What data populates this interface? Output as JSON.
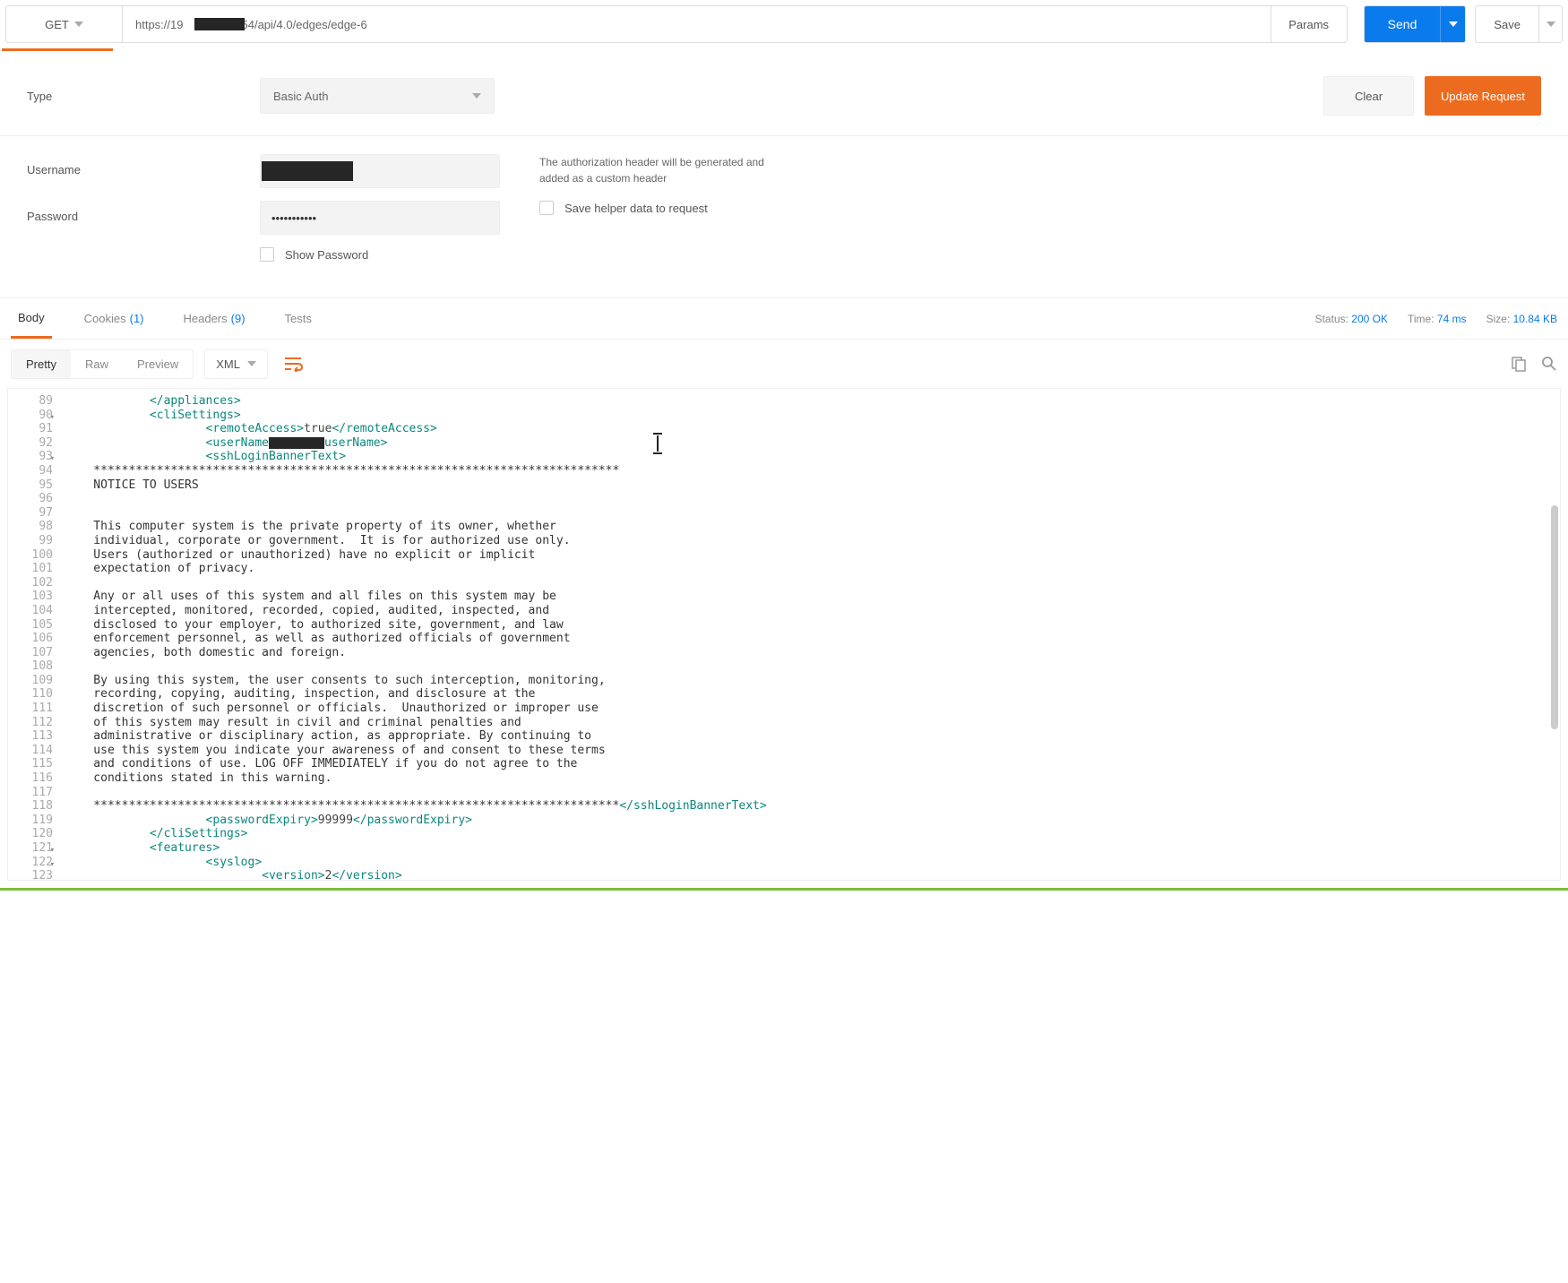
{
  "request": {
    "method": "GET",
    "url": "https://19                254/api/4.0/edges/edge-6",
    "params_label": "Params",
    "send_label": "Send",
    "save_label": "Save"
  },
  "auth": {
    "type_label": "Type",
    "type_value": "Basic Auth",
    "clear_label": "Clear",
    "update_label": "Update Request",
    "username_label": "Username",
    "password_label": "Password",
    "password_value": "•••••••••••",
    "show_password_label": "Show Password",
    "header_help": "The authorization header will be generated and added as a custom header",
    "save_helper_label": "Save helper data to request"
  },
  "response_tabs": {
    "body": "Body",
    "cookies": "Cookies",
    "cookies_count": "(1)",
    "headers": "Headers",
    "headers_count": "(9)",
    "tests": "Tests"
  },
  "response_meta": {
    "status_label": "Status:",
    "status_value": "200 OK",
    "time_label": "Time:",
    "time_value": "74 ms",
    "size_label": "Size:",
    "size_value": "10.84 KB"
  },
  "view": {
    "pretty": "Pretty",
    "raw": "Raw",
    "preview": "Preview",
    "format": "XML"
  },
  "code": {
    "line_start": 89,
    "lines": [
      {
        "n": 89,
        "indent": 2,
        "html": "<span class='tag'>&lt;/appliances&gt;</span>"
      },
      {
        "n": 90,
        "indent": 2,
        "fold": true,
        "html": "<span class='tag'>&lt;cliSettings&gt;</span>"
      },
      {
        "n": 91,
        "indent": 4,
        "html": "<span class='tag'>&lt;remoteAccess&gt;</span><span class='txt'>true</span><span class='tag'>&lt;/remoteAccess&gt;</span>"
      },
      {
        "n": 92,
        "indent": 4,
        "html": "<span class='tag'>&lt;userName</span><span class='mask-inline'></span><span class='tag'>userName&gt;</span>"
      },
      {
        "n": 93,
        "indent": 4,
        "fold": true,
        "html": "<span class='tag'>&lt;sshLoginBannerText&gt;</span>"
      },
      {
        "n": 94,
        "indent": 0,
        "html": "***************************************************************************"
      },
      {
        "n": 95,
        "indent": 0,
        "html": "NOTICE TO USERS"
      },
      {
        "n": 96,
        "indent": 0,
        "html": ""
      },
      {
        "n": 97,
        "indent": 0,
        "html": ""
      },
      {
        "n": 98,
        "indent": 0,
        "html": "This computer system is the private property of its owner, whether"
      },
      {
        "n": 99,
        "indent": 0,
        "html": "individual, corporate or government.  It is for authorized use only."
      },
      {
        "n": 100,
        "indent": 0,
        "html": "Users (authorized or unauthorized) have no explicit or implicit"
      },
      {
        "n": 101,
        "indent": 0,
        "html": "expectation of privacy."
      },
      {
        "n": 102,
        "indent": 0,
        "html": ""
      },
      {
        "n": 103,
        "indent": 0,
        "html": "Any or all uses of this system and all files on this system may be"
      },
      {
        "n": 104,
        "indent": 0,
        "html": "intercepted, monitored, recorded, copied, audited, inspected, and"
      },
      {
        "n": 105,
        "indent": 0,
        "html": "disclosed to your employer, to authorized site, government, and law"
      },
      {
        "n": 106,
        "indent": 0,
        "html": "enforcement personnel, as well as authorized officials of government"
      },
      {
        "n": 107,
        "indent": 0,
        "html": "agencies, both domestic and foreign."
      },
      {
        "n": 108,
        "indent": 0,
        "html": ""
      },
      {
        "n": 109,
        "indent": 0,
        "html": "By using this system, the user consents to such interception, monitoring,"
      },
      {
        "n": 110,
        "indent": 0,
        "html": "recording, copying, auditing, inspection, and disclosure at the"
      },
      {
        "n": 111,
        "indent": 0,
        "html": "discretion of such personnel or officials.  Unauthorized or improper use"
      },
      {
        "n": 112,
        "indent": 0,
        "html": "of this system may result in civil and criminal penalties and"
      },
      {
        "n": 113,
        "indent": 0,
        "html": "administrative or disciplinary action, as appropriate. By continuing to"
      },
      {
        "n": 114,
        "indent": 0,
        "html": "use this system you indicate your awareness of and consent to these terms"
      },
      {
        "n": 115,
        "indent": 0,
        "html": "and conditions of use. LOG OFF IMMEDIATELY if you do not agree to the"
      },
      {
        "n": 116,
        "indent": 0,
        "html": "conditions stated in this warning."
      },
      {
        "n": 117,
        "indent": 0,
        "html": ""
      },
      {
        "n": 118,
        "indent": 0,
        "html": "***************************************************************************<span class='tag'>&lt;/sshLoginBannerText&gt;</span>"
      },
      {
        "n": 119,
        "indent": 4,
        "html": "<span class='tag'>&lt;passwordExpiry&gt;</span><span class='txt'>99999</span><span class='tag'>&lt;/passwordExpiry&gt;</span>"
      },
      {
        "n": 120,
        "indent": 2,
        "html": "<span class='tag'>&lt;/cliSettings&gt;</span>"
      },
      {
        "n": 121,
        "indent": 2,
        "fold": true,
        "html": "<span class='tag'>&lt;features&gt;</span>"
      },
      {
        "n": 122,
        "indent": 4,
        "fold": true,
        "html": "<span class='tag'>&lt;syslog&gt;</span>"
      },
      {
        "n": 123,
        "indent": 6,
        "html": "<span class='tag'>&lt;version&gt;</span><span class='txt'>2</span><span class='tag'>&lt;/version&gt;</span>"
      }
    ]
  }
}
